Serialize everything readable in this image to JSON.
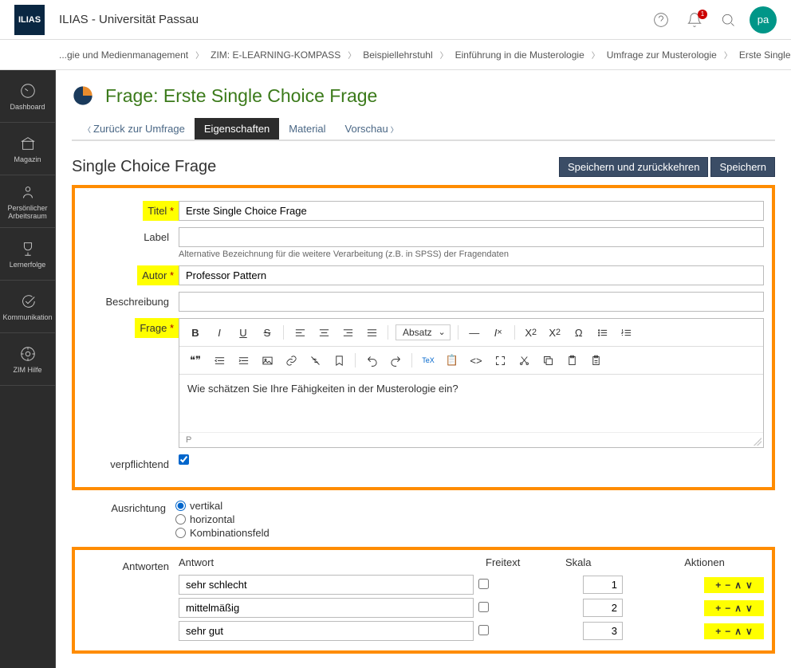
{
  "topbar": {
    "logo_text": "ILIAS",
    "site_title": "ILIAS - Universität Passau",
    "notifications": "1",
    "avatar": "pa"
  },
  "breadcrumb": [
    "...gie und Medienmanagement",
    "ZIM: E-LEARNING-KOMPASS",
    "Beispiellehrstuhl",
    "Einführung in die Musterologie",
    "Umfrage zur Musterologie",
    "Erste Single Choice Frage"
  ],
  "sidebar": {
    "items": [
      {
        "label": "Dashboard"
      },
      {
        "label": "Magazin"
      },
      {
        "label": "Persönlicher Arbeitsraum"
      },
      {
        "label": "Lernerfolge"
      },
      {
        "label": "Kommunikation"
      },
      {
        "label": "ZIM Hilfe"
      }
    ]
  },
  "page": {
    "title": "Frage: Erste Single Choice Frage"
  },
  "tabs": {
    "back": "Zurück zur Umfrage",
    "active": "Eigenschaften",
    "material": "Material",
    "preview": "Vorschau"
  },
  "section": {
    "title": "Single Choice Frage",
    "save_return": "Speichern und zurückkehren",
    "save": "Speichern"
  },
  "form": {
    "title_label": "Titel",
    "title_value": "Erste Single Choice Frage",
    "label_label": "Label",
    "label_hint": "Alternative Bezeichnung für die weitere Verarbeitung (z.B. in SPSS) der Fragendaten",
    "author_label": "Autor",
    "author_value": "Professor Pattern",
    "desc_label": "Beschreibung",
    "question_label": "Frage",
    "question_text": "Wie schätzen Sie Ihre Fähigkeiten in der Musterologie ein?",
    "editor_path": "P",
    "paragraph": "Absatz",
    "mandatory_label": "verpflichtend",
    "orientation_label": "Ausrichtung",
    "orient_v": "vertikal",
    "orient_h": "horizontal",
    "orient_c": "Kombinationsfeld"
  },
  "answers": {
    "label": "Antworten",
    "col_answer": "Antwort",
    "col_freitext": "Freitext",
    "col_skala": "Skala",
    "col_actions": "Aktionen",
    "rows": [
      {
        "text": "sehr schlecht",
        "scale": "1"
      },
      {
        "text": "mittelmäßig",
        "scale": "2"
      },
      {
        "text": "sehr gut",
        "scale": "3"
      }
    ]
  }
}
